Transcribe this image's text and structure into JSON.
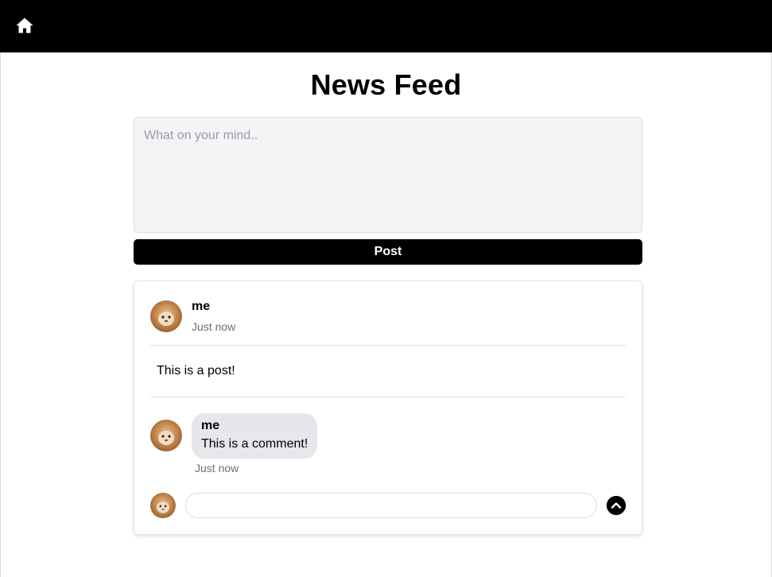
{
  "header": {
    "home_icon": "home-icon"
  },
  "page": {
    "title": "News Feed"
  },
  "composer": {
    "placeholder": "What on your mind..",
    "value": ""
  },
  "post_button": {
    "label": "Post"
  },
  "post": {
    "author": "me",
    "time": "Just now",
    "body": "This is a post!",
    "comments": [
      {
        "author": "me",
        "text": "This is a comment!",
        "time": "Just now"
      }
    ]
  },
  "comment_box": {
    "value": "",
    "send_icon": "chevron-up-icon"
  },
  "colors": {
    "topbar": "#000000",
    "button": "#000000",
    "composer_bg": "#f3f4f6",
    "bubble_bg": "#e6e7ea",
    "muted_text": "#6b6e75"
  }
}
